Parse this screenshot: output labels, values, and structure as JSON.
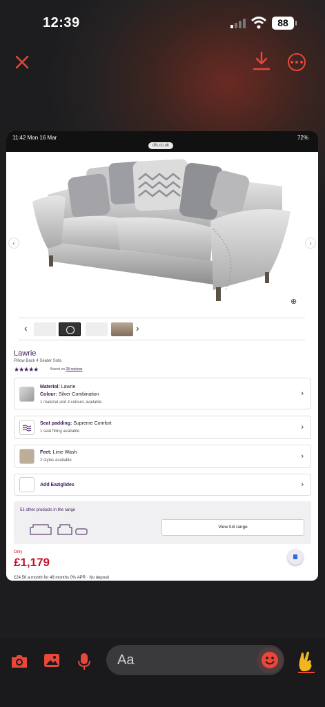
{
  "status_bar": {
    "time": "12:39",
    "battery": "88"
  },
  "shot": {
    "ipad_time": "11:42  Mon 16 Mar",
    "ipad_battery": "72%",
    "url": "dfs.co.uk",
    "product": {
      "name": "Lawrie",
      "subtitle": "Pillow Back 4 Seater Sofa",
      "stars": "★★★★★",
      "review_prefix": "Based on",
      "review_link": "28 reviews"
    },
    "options": [
      {
        "line1_label": "Material:",
        "line1_value": " Lawrie",
        "line1b_label": "Colour:",
        "line1b_value": " Silver Combination",
        "line2": "1 material and 4 colours available"
      },
      {
        "line1_label": "Seat padding:",
        "line1_value": " Supreme Comfort",
        "line2": "1 seat filling available"
      },
      {
        "line1_label": "Feet:",
        "line1_value": " Lime Wash",
        "line2": "2 styles available"
      },
      {
        "line1_label": "Add Eaziglides",
        "line1_value": "",
        "line2": ""
      }
    ],
    "range_text": "51 other products in the range",
    "range_button": "View full range",
    "only_label": "Only",
    "price": "£1,179",
    "finance": "£24.56 a month for 48 months 0% APR · No deposit"
  },
  "composer": {
    "placeholder": "Aa"
  },
  "colors": {
    "accent": "#e8473a",
    "brand_purple": "#3b1b55",
    "price_red": "#c8102e"
  }
}
